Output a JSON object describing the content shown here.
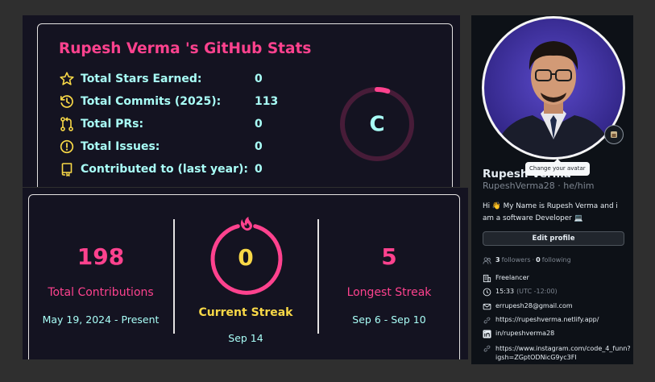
{
  "stats": {
    "title": "Rupesh Verma 's GitHub Stats",
    "rows": [
      {
        "icon": "star-icon",
        "label": "Total Stars Earned:",
        "value": "0"
      },
      {
        "icon": "history-icon",
        "label": "Total Commits (2025):",
        "value": "113"
      },
      {
        "icon": "pull-request-icon",
        "label": "Total PRs:",
        "value": "0"
      },
      {
        "icon": "issue-icon",
        "label": "Total Issues:",
        "value": "0"
      },
      {
        "icon": "repo-icon",
        "label": "Contributed to (last year):",
        "value": "0"
      }
    ],
    "rank": "C",
    "rank_progress_percent": 5
  },
  "streak": {
    "total": {
      "value": "198",
      "label": "Total Contributions",
      "range": "May 19, 2024 - Present"
    },
    "current": {
      "value": "0",
      "label": "Current Streak",
      "range": "Sep 14"
    },
    "longest": {
      "value": "5",
      "label": "Longest Streak",
      "range": "Sep 6 - Sep 10"
    }
  },
  "profile": {
    "tooltip": "Change your avatar",
    "name": "Rupesh Verma",
    "username": "RupeshVerma28",
    "pronouns": "he/him",
    "bio": "Hi 👋 My Name is Rupesh Verma and i am a software Developer 💻",
    "edit_label": "Edit profile",
    "followers_count": "3",
    "followers_label": "followers",
    "following_count": "0",
    "following_label": "following",
    "company": "Freelancer",
    "time": "15:33",
    "timezone": "(UTC -12:00)",
    "email": "errupesh28@gmail.com",
    "website": "https://rupeshverma.netlify.app/",
    "linkedin": "in/rupeshverma28",
    "instagram": "https://www.instagram.com/code_4_funn?igsh=ZGptODNicG9yc3FI"
  },
  "colors": {
    "title_pink": "#fe428e",
    "stat_cyan": "#a9fef7",
    "streak_gold": "#f8d847",
    "card_bg": "#141321",
    "profile_bg": "#0d1117"
  }
}
